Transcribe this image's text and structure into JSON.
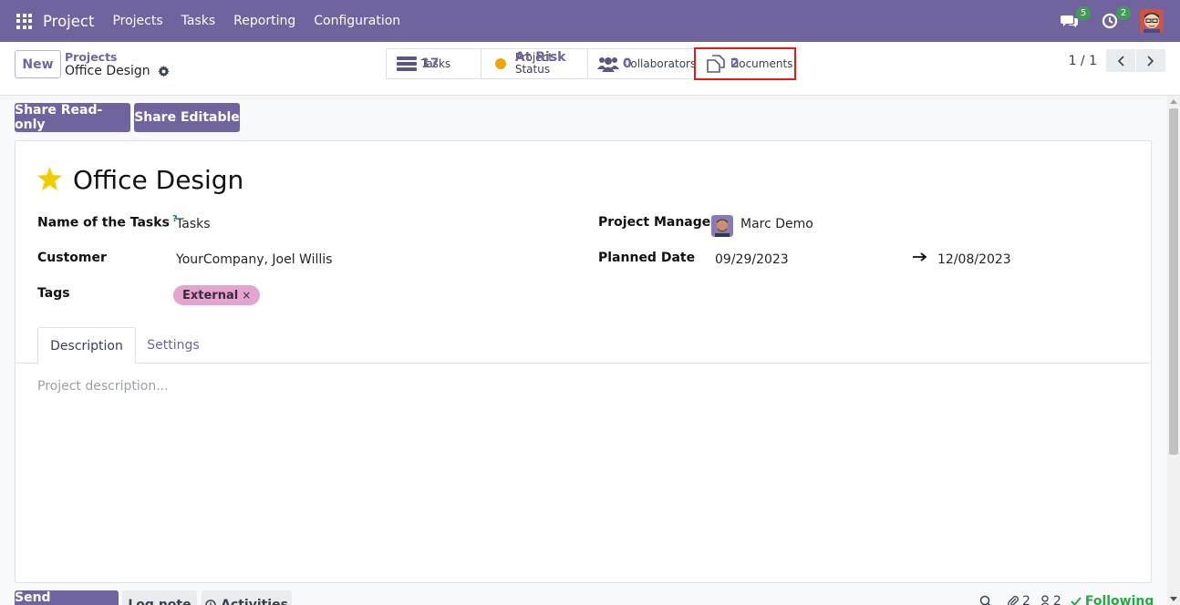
{
  "navbar": {
    "brand": "Project",
    "menu": [
      "Projects",
      "Tasks",
      "Reporting",
      "Configuration"
    ],
    "messages_count": "5",
    "activities_count": "2",
    "bg_color": "#71639e"
  },
  "control": {
    "new_label": "New",
    "breadcrumb_parent": "Projects",
    "breadcrumb_current": "Office Design",
    "smart_buttons": [
      {
        "label": "Tasks",
        "value": "17",
        "icon": "tasks-icon"
      },
      {
        "label": "Project Status",
        "value": "At Risk",
        "icon": "status-dot-icon"
      },
      {
        "label": "Collaborators",
        "value": "0",
        "icon": "users-icon"
      },
      {
        "label": "Documents",
        "value": "2",
        "icon": "documents-icon"
      }
    ],
    "pager": "1 / 1"
  },
  "actions": {
    "share_readonly": "Share Read-only",
    "share_editable": "Share Editable"
  },
  "form": {
    "title": "Office Design",
    "name_of_tasks_label": "Name of the Tasks",
    "name_of_tasks_help": "?",
    "name_of_tasks_value": "Tasks",
    "customer_label": "Customer",
    "customer_value": "YourCompany, Joel Willis",
    "tags_label": "Tags",
    "tag_value": "External",
    "tag_remove": "×",
    "project_manager_label": "Project Manager",
    "project_manager_value": "Marc Demo",
    "planned_date_label": "Planned Date",
    "planned_date_start": "09/29/2023",
    "planned_date_end": "12/08/2023",
    "tabs": [
      "Description",
      "Settings"
    ],
    "description_placeholder": "Project description..."
  },
  "chatter": {
    "send_message": "Send message",
    "log_note": "Log note",
    "activities": "Activities",
    "attachments_count": "2",
    "followers_count": "2",
    "following": "Following"
  }
}
